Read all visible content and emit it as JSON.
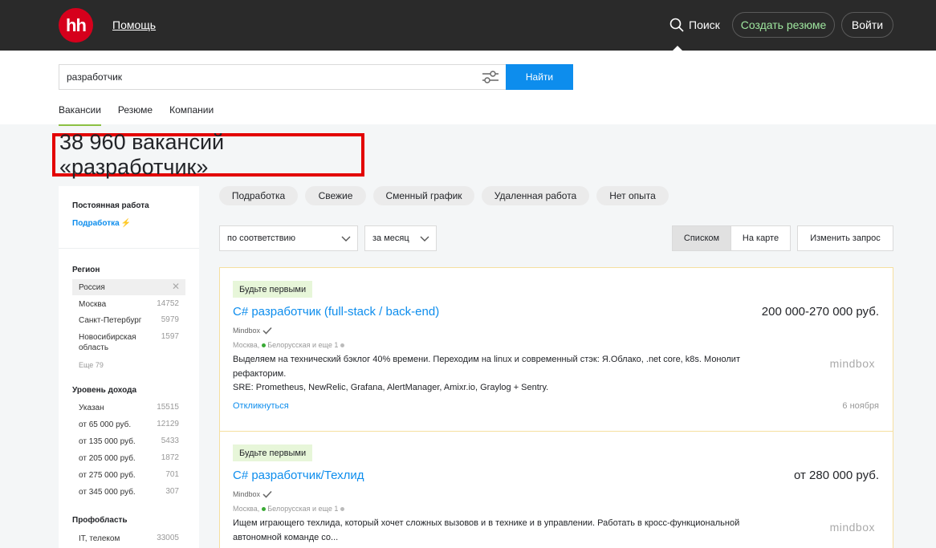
{
  "header": {
    "logo_text": "hh",
    "help_label": "Помощь",
    "search_label": "Поиск",
    "create_resume_label": "Создать резюме",
    "login_label": "Войти"
  },
  "search": {
    "query": "разработчик",
    "find_label": "Найти",
    "tabs": [
      "Вакансии",
      "Резюме",
      "Компании"
    ]
  },
  "page_title": "38 960 вакансий «разработчик»",
  "sidebar": {
    "employment_heading": "Постоянная работа",
    "parttime_link": "Подработка",
    "region_heading": "Регион",
    "regions": [
      {
        "label": "Россия",
        "count": ""
      },
      {
        "label": "Москва",
        "count": "14752"
      },
      {
        "label": "Санкт-Петербург",
        "count": "5979"
      },
      {
        "label": "Новосибирская область",
        "count": "1597"
      }
    ],
    "region_more": "Еще 79",
    "income_heading": "Уровень дохода",
    "incomes": [
      {
        "label": "Указан",
        "count": "15515"
      },
      {
        "label": "от 65 000 руб.",
        "count": "12129"
      },
      {
        "label": "от 135 000 руб.",
        "count": "5433"
      },
      {
        "label": "от 205 000 руб.",
        "count": "1872"
      },
      {
        "label": "от 275 000 руб.",
        "count": "701"
      },
      {
        "label": "от 345 000 руб.",
        "count": "307"
      }
    ],
    "area_heading": "Профобласть",
    "areas": [
      {
        "label": "IT, телеком",
        "count": "33005"
      }
    ]
  },
  "chips": [
    "Подработка",
    "Свежие",
    "Сменный график",
    "Удаленная работа",
    "Нет опыта"
  ],
  "controls": {
    "sort_value": "по соответствию",
    "period_value": "за месяц",
    "view_list": "Списком",
    "view_map": "На карте",
    "change_query": "Изменить запрос"
  },
  "vacancies": [
    {
      "badge": "Будьте первыми",
      "title": "C# разработчик (full-stack / back-end)",
      "salary": "200 000-270 000 руб.",
      "company": "Mindbox",
      "city": "Москва,",
      "metro": "Белорусская и еще 1",
      "desc_line1": "Выделяем на технический бэклог 40% времени. Переходим на linux и современный стэк: Я.Облако, .net core, k8s. Монолит рефакторим.",
      "desc_line2": "SRE: Prometheus, NewRelic, Grafana, AlertManager, Amixr.io, Graylog + Sentry.",
      "logo": "mindbox",
      "respond": "Откликнуться",
      "date": "6 ноября"
    },
    {
      "badge": "Будьте первыми",
      "title": "C# разработчик/Техлид",
      "salary": "от 280 000 руб.",
      "company": "Mindbox",
      "city": "Москва,",
      "metro": "Белорусская и еще 1",
      "desc_line1": "Ищем играющего техлида, который хочет сложных вызовов и в технике и в управлении. Работать в кросс-функциональной автономной команде со...",
      "logo": "mindbox"
    }
  ],
  "colors": {
    "header_bg": "#2a2a2a",
    "brand_red": "#d6001c",
    "link_blue": "#0d8ded",
    "highlight_border": "#e30000"
  }
}
